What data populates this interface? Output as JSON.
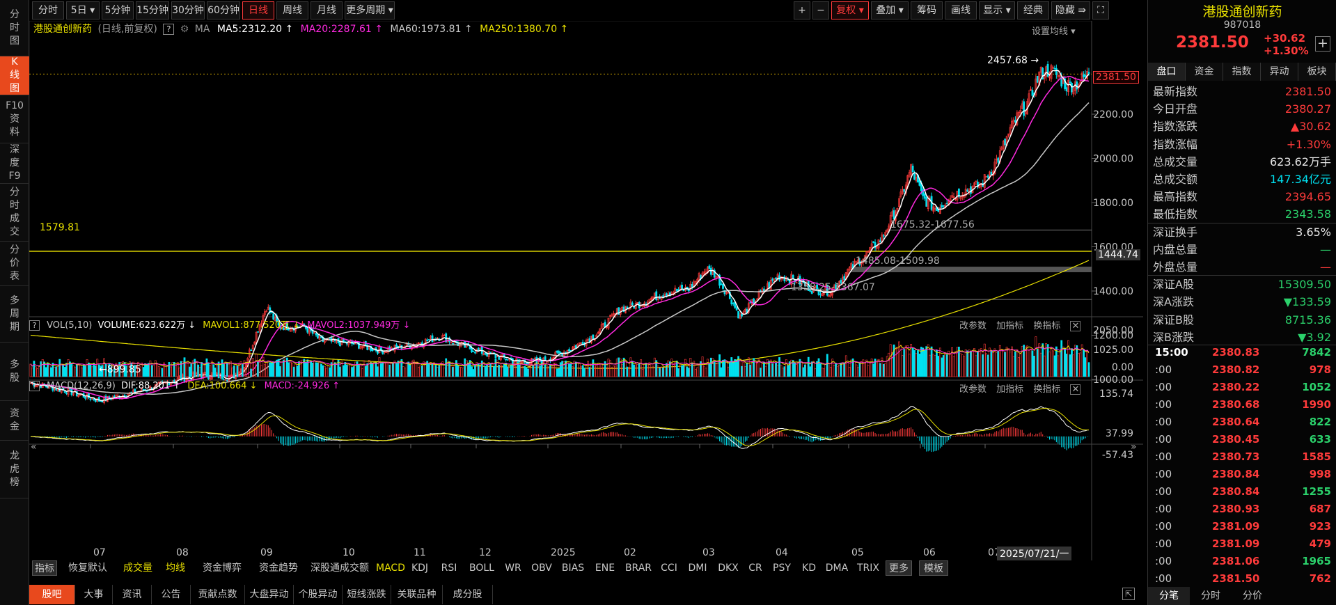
{
  "left_sidebar": [
    {
      "label": "分时图",
      "active": false
    },
    {
      "label": "K线图",
      "active": true
    },
    {
      "label": "F10资料",
      "active": false
    },
    {
      "label": "深度F9",
      "active": false
    },
    {
      "label": "分时成交",
      "active": false
    },
    {
      "label": "分价表",
      "active": false
    },
    {
      "label": "多周期",
      "active": false
    },
    {
      "label": "多股",
      "active": false
    },
    {
      "label": "资金",
      "active": false
    },
    {
      "label": "龙虎榜",
      "active": false
    }
  ],
  "toolbar": {
    "periods": [
      "分时",
      "5日 ▾",
      "5分钟",
      "15分钟",
      "30分钟",
      "60分钟",
      "日线",
      "周线",
      "月线",
      "更多周期 ▾"
    ],
    "active_period": "日线",
    "right_tools": [
      "+",
      "−",
      "复权 ▾",
      "叠加 ▾",
      "筹码",
      "画线",
      "显示 ▾",
      "经典",
      "隐藏 ⇛",
      "⛶"
    ]
  },
  "chart_header": {
    "name": "港股通创新药",
    "mode": "(日线,前复权)",
    "ma_label": "MA",
    "ma5": "MA5:2312.20 ↑",
    "ma20": "MA20:2287.61 ↑",
    "ma60": "MA60:1973.81 ↑",
    "ma250": "MA250:1380.70 ↑",
    "settings": "设置均线 ▾"
  },
  "vol_header": {
    "name": "VOL(5,10)",
    "volume": "VOLUME:623.622万 ↓",
    "mavol1": "MAVOL1:877.520万 ↓",
    "mavol2": "MAVOL2:1037.949万 ↓",
    "actions": [
      "改参数",
      "加指标",
      "换指标"
    ]
  },
  "macd_header": {
    "name": "MACD(12,26,9)",
    "dif": "DIF:88.201 ↑",
    "dea": "DEA:100.664 ↓",
    "macd": "MACD:-24.926 ↑",
    "actions": [
      "改参数",
      "加指标",
      "换指标"
    ]
  },
  "annotations": {
    "high": "2457.68",
    "low": "899.85",
    "hline": "1579.81",
    "current_price": "2381.50",
    "band_price": "1444.74",
    "zone1": "1675.32-1677.56",
    "zone2": "1485.08-1509.98",
    "zone3": "1358.25-1367.07",
    "cursor_date": "2025/07/21/一"
  },
  "chart_data": {
    "type": "candlestick",
    "price_axis": {
      "ticks": [
        1000,
        1200,
        1400,
        1600,
        1800,
        2000,
        2200
      ],
      "labels": [
        "1000.00",
        "1200.00",
        "1400.00",
        "1600.00",
        "1800.00",
        "2000.00",
        "2200.00"
      ],
      "ylim": [
        930,
        2480
      ]
    },
    "vol_axis": {
      "labels": [
        "2050.00",
        "1025.00",
        "0.00"
      ],
      "ylim": [
        0,
        2050
      ]
    },
    "macd_axis": {
      "labels": [
        "135.74",
        "37.99",
        "-57.43"
      ],
      "ylim": [
        -57.43,
        135.74
      ]
    },
    "x_ticks": [
      "07",
      "08",
      "09",
      "10",
      "11",
      "12",
      "2025",
      "02",
      "03",
      "04",
      "05",
      "06",
      "07"
    ],
    "close_anchors": [
      [
        0,
        985
      ],
      [
        20,
        950
      ],
      [
        40,
        905
      ],
      [
        55,
        930
      ],
      [
        70,
        960
      ],
      [
        85,
        1000
      ],
      [
        100,
        1020
      ],
      [
        118,
        1010
      ],
      [
        125,
        1060
      ],
      [
        133,
        1230
      ],
      [
        138,
        1330
      ],
      [
        145,
        1240
      ],
      [
        160,
        1240
      ],
      [
        170,
        1175
      ],
      [
        190,
        1160
      ],
      [
        205,
        1130
      ],
      [
        225,
        1160
      ],
      [
        240,
        1195
      ],
      [
        255,
        1145
      ],
      [
        270,
        1110
      ],
      [
        285,
        1080
      ],
      [
        300,
        1085
      ],
      [
        315,
        1135
      ],
      [
        330,
        1200
      ],
      [
        345,
        1320
      ],
      [
        355,
        1340
      ],
      [
        370,
        1390
      ],
      [
        385,
        1410
      ],
      [
        395,
        1500
      ],
      [
        400,
        1480
      ],
      [
        410,
        1360
      ],
      [
        415,
        1280
      ],
      [
        425,
        1370
      ],
      [
        437,
        1470
      ],
      [
        448,
        1450
      ],
      [
        458,
        1405
      ],
      [
        468,
        1400
      ],
      [
        478,
        1490
      ],
      [
        488,
        1560
      ],
      [
        498,
        1640
      ],
      [
        508,
        1800
      ],
      [
        515,
        1955
      ],
      [
        522,
        1820
      ],
      [
        530,
        1770
      ],
      [
        538,
        1830
      ],
      [
        548,
        1860
      ],
      [
        556,
        1880
      ],
      [
        566,
        2000
      ],
      [
        575,
        2160
      ],
      [
        584,
        2260
      ],
      [
        590,
        2380
      ],
      [
        596,
        2400
      ],
      [
        600,
        2380
      ],
      [
        606,
        2330
      ],
      [
        612,
        2340
      ],
      [
        619,
        2381.5
      ]
    ],
    "ma_values_last": {
      "MA5": 2312.2,
      "MA20": 2287.61,
      "MA60": 1973.81,
      "MA250": 1380.7
    },
    "last_volume_wan": 623.622,
    "last_macd": {
      "DIF": 88.201,
      "DEA": 100.664,
      "MACD": -24.926
    },
    "colors": {
      "up": "#ff3b3b",
      "down": "#00e0f0",
      "ma5": "#ffffff",
      "ma20": "#ff2ae0",
      "ma60": "#c8c8c8",
      "ma250": "#e8e000"
    }
  },
  "indicator_tabs": [
    "指标",
    "恢复默认",
    "成交量",
    "均线",
    "资金博弈",
    "资金趋势",
    "深股通成交额",
    "MACD",
    "KDJ",
    "RSI",
    "BOLL",
    "WR",
    "OBV",
    "BIAS",
    "ENE",
    "BRAR",
    "CCI",
    "DMI",
    "DKX",
    "CR",
    "PSY",
    "KD",
    "DMA",
    "TRIX",
    "更多",
    "模板"
  ],
  "bottom_tabs": [
    "股吧",
    "大事",
    "资讯",
    "公告",
    "贡献点数",
    "大盘异动",
    "个股异动",
    "短线涨跌",
    "关联品种",
    "成分股"
  ],
  "right_panel": {
    "title": "港股通创新药",
    "code": "987018",
    "price": "2381.50",
    "change": "+30.62",
    "change_pct": "+1.30%",
    "tabs": [
      "盘口",
      "资金",
      "指数",
      "异动",
      "板块"
    ],
    "stats": [
      {
        "k": "最新指数",
        "v": "2381.50",
        "c": "red"
      },
      {
        "k": "今日开盘",
        "v": "2380.27",
        "c": "red"
      },
      {
        "k": "指数涨跌",
        "v": "▲30.62",
        "c": "red"
      },
      {
        "k": "指数涨幅",
        "v": "+1.30%",
        "c": "red"
      },
      {
        "k": "总成交量",
        "v": "623.62万手",
        "c": "white"
      },
      {
        "k": "总成交额",
        "v": "147.34亿元",
        "c": "cyan"
      },
      {
        "k": "最高指数",
        "v": "2394.65",
        "c": "red"
      },
      {
        "k": "最低指数",
        "v": "2343.58",
        "c": "green"
      },
      {
        "k": "深证换手",
        "v": "3.65%",
        "c": "white"
      },
      {
        "k": "内盘总量",
        "v": "—",
        "c": "green"
      },
      {
        "k": "外盘总量",
        "v": "—",
        "c": "red"
      },
      {
        "k": "深证A股",
        "v": "15309.50",
        "c": "green"
      },
      {
        "k": "深A涨跌",
        "v": "▼133.59",
        "c": "green"
      },
      {
        "k": "深证B股",
        "v": "8715.36",
        "c": "green"
      },
      {
        "k": "深B涨跌",
        "v": "▼3.92",
        "c": "green"
      }
    ],
    "ticks": [
      {
        "t": "15:00",
        "p": "2380.83",
        "v": "7842",
        "c": "green"
      },
      {
        "t": ":00",
        "p": "2380.82",
        "v": "978",
        "c": "red"
      },
      {
        "t": ":00",
        "p": "2380.22",
        "v": "1052",
        "c": "green"
      },
      {
        "t": ":00",
        "p": "2380.68",
        "v": "1990",
        "c": "red"
      },
      {
        "t": ":00",
        "p": "2380.64",
        "v": "822",
        "c": "green"
      },
      {
        "t": ":00",
        "p": "2380.45",
        "v": "633",
        "c": "green"
      },
      {
        "t": ":00",
        "p": "2380.73",
        "v": "1585",
        "c": "red"
      },
      {
        "t": ":00",
        "p": "2380.84",
        "v": "998",
        "c": "red"
      },
      {
        "t": ":00",
        "p": "2380.84",
        "v": "1255",
        "c": "green"
      },
      {
        "t": ":00",
        "p": "2380.93",
        "v": "687",
        "c": "red"
      },
      {
        "t": ":00",
        "p": "2381.09",
        "v": "923",
        "c": "red"
      },
      {
        "t": ":00",
        "p": "2381.09",
        "v": "479",
        "c": "red"
      },
      {
        "t": ":00",
        "p": "2381.06",
        "v": "1965",
        "c": "green"
      },
      {
        "t": ":00",
        "p": "2381.50",
        "v": "762",
        "c": "red"
      }
    ],
    "bottom_tabs": [
      "分笔",
      "分时",
      "分价"
    ]
  }
}
